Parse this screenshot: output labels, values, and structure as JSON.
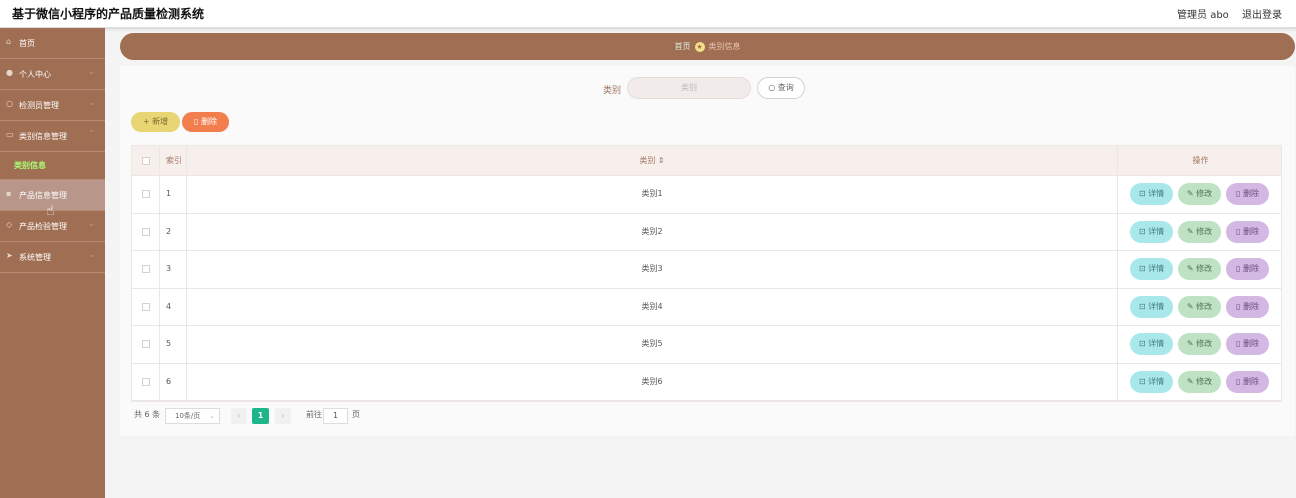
{
  "header": {
    "title": "基于微信小程序的产品质量检测系统",
    "user": "管理员 abo",
    "logout": "退出登录"
  },
  "sidebar": {
    "items": [
      {
        "label": "首页",
        "icon": "home-icon",
        "chevron": false
      },
      {
        "label": "个人中心",
        "icon": "user-icon",
        "chevron": true
      },
      {
        "label": "检测员管理",
        "icon": "chat-icon",
        "chevron": true
      },
      {
        "label": "类别信息管理",
        "icon": "id-card-icon",
        "chevron": true
      },
      {
        "label": "产品信息管理",
        "icon": "message-icon",
        "chevron": true
      },
      {
        "label": "产品检验管理",
        "icon": "tag-icon",
        "chevron": true
      },
      {
        "label": "系统管理",
        "icon": "send-icon",
        "chevron": true
      }
    ],
    "active_sub": "类别信息"
  },
  "breadcrumb": {
    "home": "首页",
    "current": "类别信息"
  },
  "search": {
    "label": "类别",
    "placeholder": "类别",
    "button": "查询"
  },
  "actions": {
    "add": "新增",
    "delete": "删除"
  },
  "table": {
    "headers": {
      "index": "索引",
      "category": "类别",
      "ops": "操作"
    },
    "rows": [
      {
        "index": "1",
        "category": "类别1"
      },
      {
        "index": "2",
        "category": "类别2"
      },
      {
        "index": "3",
        "category": "类别3"
      },
      {
        "index": "4",
        "category": "类别4"
      },
      {
        "index": "5",
        "category": "类别5"
      },
      {
        "index": "6",
        "category": "类别6"
      }
    ],
    "op_labels": {
      "detail": "详情",
      "edit": "修改",
      "delete": "删除"
    }
  },
  "pagination": {
    "total": "共 6 条",
    "page_size": "10条/页",
    "current_page": "1",
    "goto_label": "前往",
    "goto_value": "1",
    "page_suffix": "页"
  },
  "colors": {
    "sidebar": "#a06e52",
    "accent_green": "#1fb58a",
    "detail": "#a8e8ea",
    "edit": "#bfe2c4",
    "delete": "#d3b8e3"
  }
}
